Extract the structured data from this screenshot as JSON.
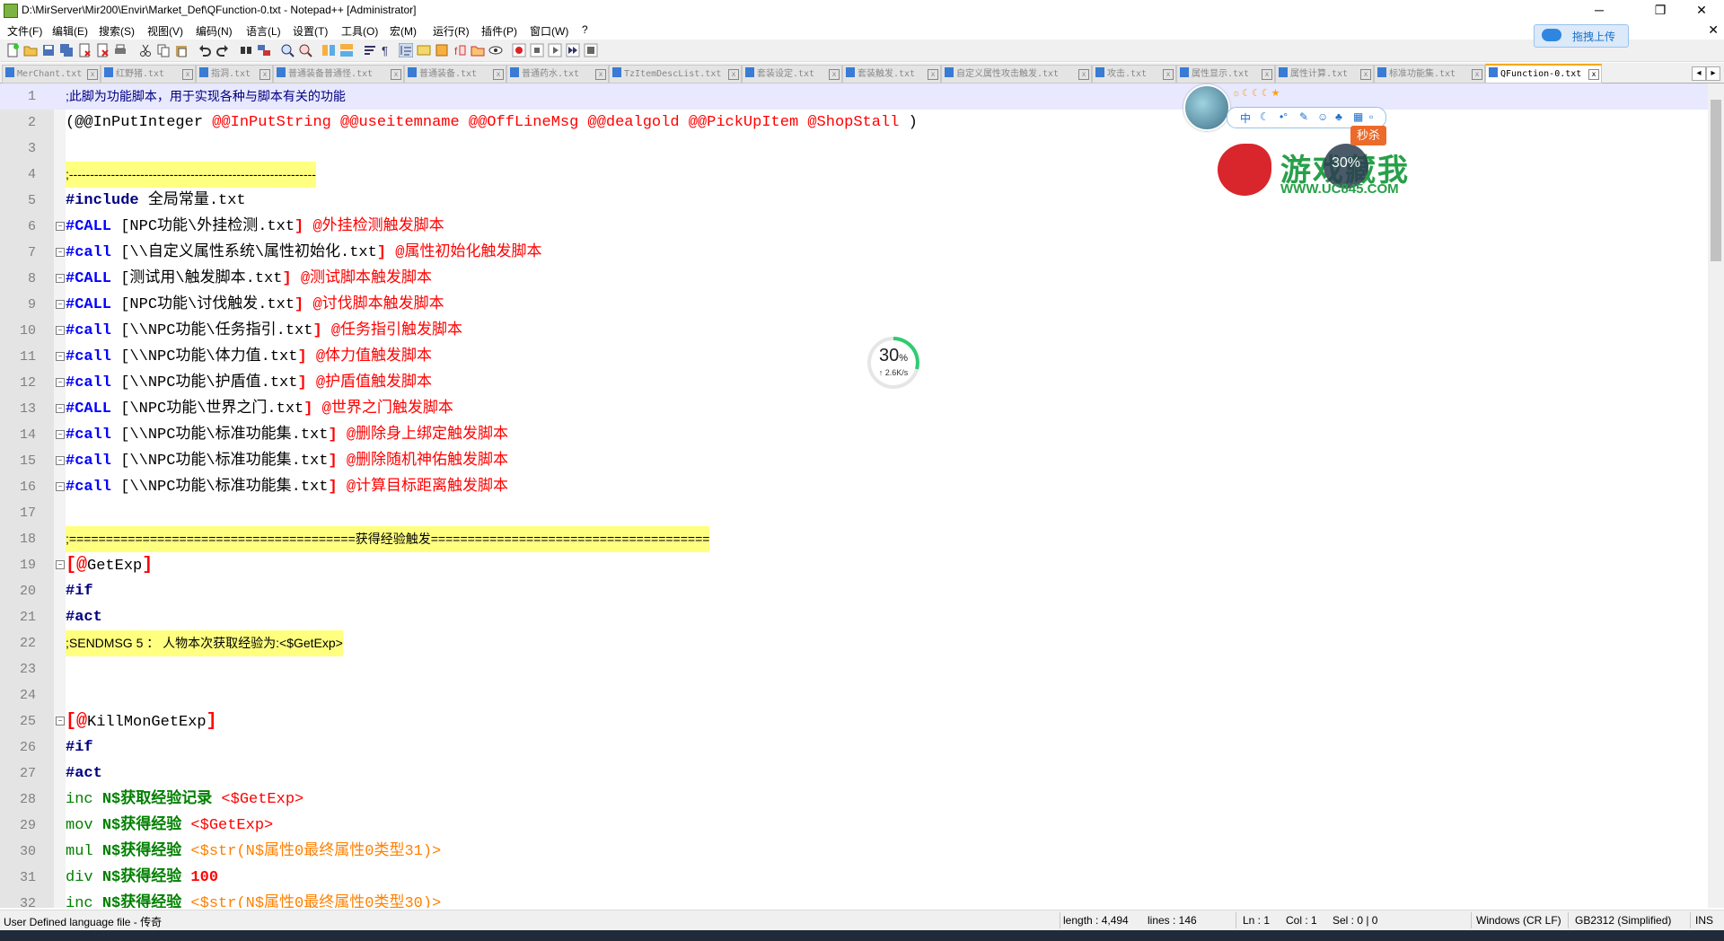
{
  "window": {
    "title": "D:\\MirServer\\Mir200\\Envir\\Market_Def\\QFunction-0.txt - Notepad++ [Administrator]",
    "minimize": "─",
    "maximize": "❐",
    "close": "✕"
  },
  "menu": [
    "文件(F)",
    "编辑(E)",
    "搜索(S)",
    "视图(V)",
    "编码(N)",
    "语言(L)",
    "设置(T)",
    "工具(O)",
    "宏(M)",
    "运行(R)",
    "插件(P)",
    "窗口(W)",
    "?"
  ],
  "menu_close": "✕",
  "upload_button": "拖拽上传",
  "tabs": [
    "MerChant.txt",
    "红野猪.txt",
    "指洞.txt",
    "普通装备普通怪.txt",
    "普通装备.txt",
    "普通药水.txt",
    "TzItemDescList.txt",
    "套装设定.txt",
    "套装触发.txt",
    "自定义属性攻击触发.txt",
    "攻击.txt",
    "属性显示.txt",
    "属性计算.txt",
    "标准功能集.txt",
    "QFunction-0.txt"
  ],
  "tab_prev": "◂",
  "tab_next": "▸",
  "editor": {
    "lines": [
      {
        "n": "1",
        "t": ";此脚为功能脚本，用于实现各种与脚本有关的功能"
      },
      {
        "n": "2",
        "a": "(@@InPutInteger ",
        "b": "@@InPutString @@useitemname @@OffLineMsg @@dealgold @@PickUpItem @ShopStall ",
        "c": ")"
      },
      {
        "n": "3"
      },
      {
        "n": "4",
        "t": ";-----------------------------------------------------------"
      },
      {
        "n": "5",
        "a": "#include",
        "b": " 全局常量.txt"
      },
      {
        "n": "6",
        "a": "#CALL",
        "b": " [NPC功能\\外挂检测.txt",
        "c": "]",
        "d": " @外挂检测触发脚本"
      },
      {
        "n": "7",
        "a": "#call",
        "b": " [\\\\自定义属性系统\\属性初始化.txt",
        "c": "]",
        "d": " @属性初始化触发脚本"
      },
      {
        "n": "8",
        "a": "#CALL",
        "b": " [测试用\\触发脚本.txt",
        "c": "]",
        "d": " @测试脚本触发脚本"
      },
      {
        "n": "9",
        "a": "#CALL",
        "b": " [NPC功能\\讨伐触发.txt",
        "c": "]",
        "d": " @讨伐脚本触发脚本"
      },
      {
        "n": "10",
        "a": "#call",
        "b": " [\\\\NPC功能\\任务指引.txt",
        "c": "]",
        "d": " @任务指引触发脚本"
      },
      {
        "n": "11",
        "a": "#call",
        "b": " [\\\\NPC功能\\体力值.txt",
        "c": "]",
        "d": " @体力值触发脚本"
      },
      {
        "n": "12",
        "a": "#call",
        "b": " [\\\\NPC功能\\护盾值.txt",
        "c": "]",
        "d": " @护盾值触发脚本"
      },
      {
        "n": "13",
        "a": "#CALL",
        "b": " [\\NPC功能\\世界之门.txt",
        "c": "]",
        "d": " @世界之门触发脚本"
      },
      {
        "n": "14",
        "a": "#call",
        "b": " [\\\\NPC功能\\标准功能集.txt",
        "c": "]",
        "d": " @删除身上绑定触发脚本"
      },
      {
        "n": "15",
        "a": "#call",
        "b": " [\\\\NPC功能\\标准功能集.txt",
        "c": "]",
        "d": " @删除随机神佑触发脚本"
      },
      {
        "n": "16",
        "a": "#call",
        "b": " [\\\\NPC功能\\标准功能集.txt",
        "c": "]",
        "d": " @计算目标距离触发脚本"
      },
      {
        "n": "17"
      },
      {
        "n": "18",
        "t": ";=======================================获得经验触发======================================"
      },
      {
        "n": "19",
        "a": "[@",
        "b": "GetExp",
        "c": "]"
      },
      {
        "n": "20",
        "a": "#if"
      },
      {
        "n": "21",
        "a": "#act"
      },
      {
        "n": "22",
        "t": ";SENDMSG 5 ： 人物本次获取经验为:<$GetExp>"
      },
      {
        "n": "23"
      },
      {
        "n": "24"
      },
      {
        "n": "25",
        "a": "[@",
        "b": "KillMonGetExp",
        "c": "]"
      },
      {
        "n": "26",
        "a": "#if"
      },
      {
        "n": "27",
        "a": "#act"
      },
      {
        "n": "28",
        "a": "inc ",
        "b": "N$获取经验记录 ",
        "c": "<$GetExp>"
      },
      {
        "n": "29",
        "a": "mov ",
        "b": "N$获得经验 ",
        "c": "<$GetExp>"
      },
      {
        "n": "30",
        "a": "mul ",
        "b": "N$获得经验 ",
        "c": "<$str(N$属性0最终属性0类型31)>"
      },
      {
        "n": "31",
        "a": "div ",
        "b": "N$获得经验 ",
        "c": "100"
      },
      {
        "n": "32",
        "a": "inc ",
        "b": "N$获得经验 ",
        "c": "<$str(N$属性0最终属性0类型30)>"
      }
    ]
  },
  "status": {
    "file_type": "User Defined language file - 传奇",
    "length": "length : 4,494",
    "lines": "lines : 146",
    "ln": "Ln : 1",
    "col": "Col : 1",
    "sel": "Sel : 0 | 0",
    "eol": "Windows (CR LF)",
    "encoding": "GB2312 (Simplified)",
    "mode": "INS"
  },
  "speed_widget": {
    "percent": "30",
    "unit": "%",
    "rate": "↑ 2.6K/s"
  },
  "ime_bar": {
    "label": "中",
    "weather": "☼☾☾☾★"
  },
  "watermark": {
    "name": "游戏藏我",
    "url": "WWW.UC845.COM",
    "badge": "秒杀",
    "cpu": "30%"
  },
  "colors": {
    "accent": "#f7a800",
    "comment_bg": "#ffff80",
    "keyword": "#0000ff",
    "string": "#ff0000",
    "label": "#008000",
    "orange": "#ff8000"
  }
}
